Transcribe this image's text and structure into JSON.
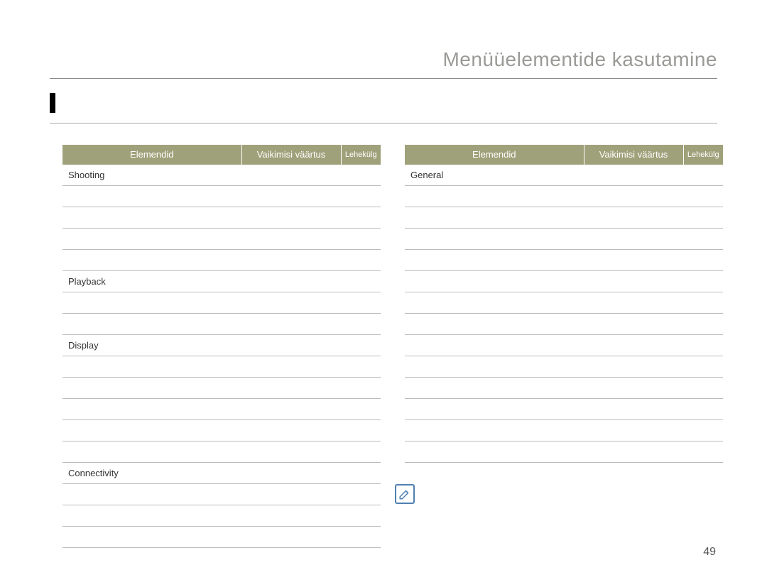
{
  "header": {
    "title": "Menüüelementide kasutamine"
  },
  "table_headers": {
    "col1": "Elemendid",
    "col2": "",
    "col3": "Vaikimisi väärtus",
    "col4": "Lehekülg"
  },
  "left_table": {
    "rows": [
      {
        "c1": "Shooting",
        "c2": "",
        "c3": "",
        "c4": ""
      },
      {
        "c1": "",
        "c2": "",
        "c3": "",
        "c4": ""
      },
      {
        "c1": "",
        "c2": "",
        "c3": "",
        "c4": ""
      },
      {
        "c1": "",
        "c2": "",
        "c3": "",
        "c4": ""
      },
      {
        "c1": "",
        "c2": "",
        "c3": "",
        "c4": ""
      },
      {
        "c1": "Playback",
        "c2": "",
        "c3": "",
        "c4": ""
      },
      {
        "c1": "",
        "c2": "",
        "c3": "",
        "c4": ""
      },
      {
        "c1": "",
        "c2": "",
        "c3": "",
        "c4": ""
      },
      {
        "c1": "Display",
        "c2": "",
        "c3": "",
        "c4": ""
      },
      {
        "c1": "",
        "c2": "",
        "c3": "",
        "c4": ""
      },
      {
        "c1": "",
        "c2": "",
        "c3": "",
        "c4": ""
      },
      {
        "c1": "",
        "c2": "",
        "c3": "",
        "c4": ""
      },
      {
        "c1": "",
        "c2": "",
        "c3": "",
        "c4": ""
      },
      {
        "c1": "",
        "c2": "",
        "c3": "",
        "c4": ""
      },
      {
        "c1": "Connectivity",
        "c2": "",
        "c3": "",
        "c4": ""
      },
      {
        "c1": "",
        "c2": "",
        "c3": "",
        "c4": ""
      },
      {
        "c1": "",
        "c2": "",
        "c3": "",
        "c4": ""
      },
      {
        "c1": "",
        "c2": "",
        "c3": "",
        "c4": ""
      }
    ]
  },
  "right_table": {
    "rows": [
      {
        "c1": "General",
        "c2": "",
        "c3": "",
        "c4": ""
      },
      {
        "c1": "",
        "c2": "",
        "c3": "",
        "c4": ""
      },
      {
        "c1": "",
        "c2": "",
        "c3": "",
        "c4": ""
      },
      {
        "c1": "",
        "c2": "",
        "c3": "",
        "c4": ""
      },
      {
        "c1": "",
        "c2": "",
        "c3": "",
        "c4": ""
      },
      {
        "c1": "",
        "c2": "",
        "c3": "",
        "c4": ""
      },
      {
        "c1": "",
        "c2": "",
        "c3": "",
        "c4": ""
      },
      {
        "c1": "",
        "c2": "",
        "c3": "",
        "c4": ""
      },
      {
        "c1": "",
        "c2": "",
        "c3": "",
        "c4": ""
      },
      {
        "c1": "",
        "c2": "",
        "c3": "",
        "c4": ""
      },
      {
        "c1": "",
        "c2": "",
        "c3": "",
        "c4": ""
      },
      {
        "c1": "",
        "c2": "",
        "c3": "",
        "c4": ""
      },
      {
        "c1": "",
        "c2": "",
        "c3": "",
        "c4": ""
      },
      {
        "c1": "",
        "c2": "",
        "c3": "",
        "c4": ""
      }
    ]
  },
  "page_number": "49"
}
